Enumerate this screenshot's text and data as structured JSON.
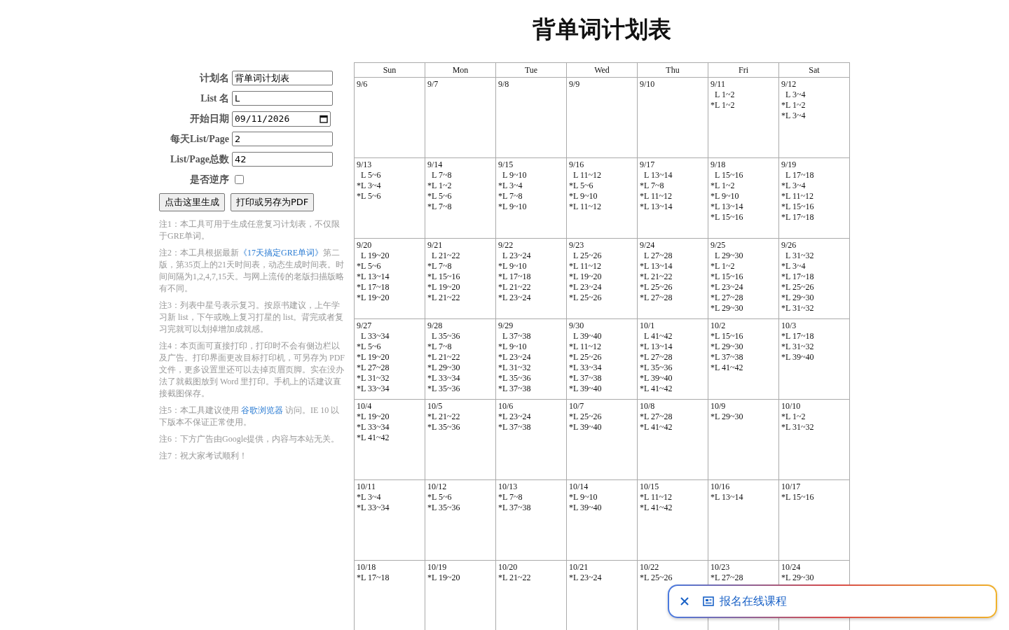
{
  "title": "背单词计划表",
  "form": {
    "fields": [
      {
        "kind": "text",
        "label": "计划名",
        "value": "背单词计划表"
      },
      {
        "kind": "text",
        "label": "List 名",
        "value": "L"
      },
      {
        "kind": "date",
        "label": "开始日期",
        "value": "09/11/2026"
      },
      {
        "kind": "text",
        "label": "每天List/Page",
        "value": "2"
      },
      {
        "kind": "text",
        "label": "List/Page总数",
        "value": "42"
      },
      {
        "kind": "checkbox",
        "label": "是否逆序",
        "checked": false
      }
    ],
    "buttons": [
      "点击这里生成",
      "打印或另存为PDF"
    ]
  },
  "notes": [
    {
      "text": "注1：本工具可用于生成任意复习计划表，不仅限于GRE单词。"
    },
    {
      "text": "注2：本工具根据最新",
      "link": "《17天搞定GRE单词》",
      "after": "第二版，第35页上的21天时间表，动态生成时间表。时间间隔为1,2,4,7,15天。与网上流传的老版扫描版略有不同。"
    },
    {
      "text": "注3：列表中星号表示复习。按原书建议，上午学习新 list，下午或晚上复习打星的 list。背完或者复习完就可以划掉增加成就感。"
    },
    {
      "text": "注4：本页面可直接打印，打印时不会有侧边栏以及广告。打印界面更改目标打印机，可另存为 PDF 文件，更多设置里还可以去掉页眉页脚。实在没办法了就截图放到 Word 里打印。手机上的话建议直接截图保存。"
    },
    {
      "text": "注5：本工具建议使用 ",
      "link": "谷歌浏览器",
      "after": " 访问。IE 10 以下版本不保证正常使用。"
    },
    {
      "text": "注6：下方广告由Google提供，内容与本站无关。"
    },
    {
      "text": "注7：祝大家考试顺利！"
    }
  ],
  "calendar": {
    "columns": [
      "Sun",
      "Mon",
      "Tue",
      "Wed",
      "Thu",
      "Fri",
      "Sat"
    ],
    "weeks": [
      [
        {
          "date": "9/6"
        },
        {
          "date": "9/7"
        },
        {
          "date": "9/8"
        },
        {
          "date": "9/9"
        },
        {
          "date": "9/10"
        },
        {
          "date": "9/11",
          "new": "L 1~2",
          "reviews": [
            "*L 1~2"
          ]
        },
        {
          "date": "9/12",
          "new": "L 3~4",
          "reviews": [
            "*L 1~2",
            "*L 3~4"
          ]
        }
      ],
      [
        {
          "date": "9/13",
          "new": "L 5~6",
          "reviews": [
            "*L 3~4",
            "*L 5~6"
          ]
        },
        {
          "date": "9/14",
          "new": "L 7~8",
          "reviews": [
            "*L 1~2",
            "*L 5~6",
            "*L 7~8"
          ]
        },
        {
          "date": "9/15",
          "new": "L 9~10",
          "reviews": [
            "*L 3~4",
            "*L 7~8",
            "*L 9~10"
          ]
        },
        {
          "date": "9/16",
          "new": "L 11~12",
          "reviews": [
            "*L 5~6",
            "*L 9~10",
            "*L 11~12"
          ]
        },
        {
          "date": "9/17",
          "new": "L 13~14",
          "reviews": [
            "*L 7~8",
            "*L 11~12",
            "*L 13~14"
          ]
        },
        {
          "date": "9/18",
          "new": "L 15~16",
          "reviews": [
            "*L 1~2",
            "*L 9~10",
            "*L 13~14",
            "*L 15~16"
          ]
        },
        {
          "date": "9/19",
          "new": "L 17~18",
          "reviews": [
            "*L 3~4",
            "*L 11~12",
            "*L 15~16",
            "*L 17~18"
          ]
        }
      ],
      [
        {
          "date": "9/20",
          "new": "L 19~20",
          "reviews": [
            "*L 5~6",
            "*L 13~14",
            "*L 17~18",
            "*L 19~20"
          ]
        },
        {
          "date": "9/21",
          "new": "L 21~22",
          "reviews": [
            "*L 7~8",
            "*L 15~16",
            "*L 19~20",
            "*L 21~22"
          ]
        },
        {
          "date": "9/22",
          "new": "L 23~24",
          "reviews": [
            "*L 9~10",
            "*L 17~18",
            "*L 21~22",
            "*L 23~24"
          ]
        },
        {
          "date": "9/23",
          "new": "L 25~26",
          "reviews": [
            "*L 11~12",
            "*L 19~20",
            "*L 23~24",
            "*L 25~26"
          ]
        },
        {
          "date": "9/24",
          "new": "L 27~28",
          "reviews": [
            "*L 13~14",
            "*L 21~22",
            "*L 25~26",
            "*L 27~28"
          ]
        },
        {
          "date": "9/25",
          "new": "L 29~30",
          "reviews": [
            "*L 1~2",
            "*L 15~16",
            "*L 23~24",
            "*L 27~28",
            "*L 29~30"
          ]
        },
        {
          "date": "9/26",
          "new": "L 31~32",
          "reviews": [
            "*L 3~4",
            "*L 17~18",
            "*L 25~26",
            "*L 29~30",
            "*L 31~32"
          ]
        }
      ],
      [
        {
          "date": "9/27",
          "new": "L 33~34",
          "reviews": [
            "*L 5~6",
            "*L 19~20",
            "*L 27~28",
            "*L 31~32",
            "*L 33~34"
          ]
        },
        {
          "date": "9/28",
          "new": "L 35~36",
          "reviews": [
            "*L 7~8",
            "*L 21~22",
            "*L 29~30",
            "*L 33~34",
            "*L 35~36"
          ]
        },
        {
          "date": "9/29",
          "new": "L 37~38",
          "reviews": [
            "*L 9~10",
            "*L 23~24",
            "*L 31~32",
            "*L 35~36",
            "*L 37~38"
          ]
        },
        {
          "date": "9/30",
          "new": "L 39~40",
          "reviews": [
            "*L 11~12",
            "*L 25~26",
            "*L 33~34",
            "*L 37~38",
            "*L 39~40"
          ]
        },
        {
          "date": "10/1",
          "new": "L 41~42",
          "reviews": [
            "*L 13~14",
            "*L 27~28",
            "*L 35~36",
            "*L 39~40",
            "*L 41~42"
          ]
        },
        {
          "date": "10/2",
          "reviews": [
            "*L 15~16",
            "*L 29~30",
            "*L 37~38",
            "*L 41~42"
          ]
        },
        {
          "date": "10/3",
          "reviews": [
            "*L 17~18",
            "*L 31~32",
            "*L 39~40"
          ]
        }
      ],
      [
        {
          "date": "10/4",
          "reviews": [
            "*L 19~20",
            "*L 33~34",
            "*L 41~42"
          ]
        },
        {
          "date": "10/5",
          "reviews": [
            "*L 21~22",
            "*L 35~36"
          ]
        },
        {
          "date": "10/6",
          "reviews": [
            "*L 23~24",
            "*L 37~38"
          ]
        },
        {
          "date": "10/7",
          "reviews": [
            "*L 25~26",
            "*L 39~40"
          ]
        },
        {
          "date": "10/8",
          "reviews": [
            "*L 27~28",
            "*L 41~42"
          ]
        },
        {
          "date": "10/9",
          "reviews": [
            "*L 29~30"
          ]
        },
        {
          "date": "10/10",
          "reviews": [
            "*L 1~2",
            "*L 31~32"
          ]
        }
      ],
      [
        {
          "date": "10/11",
          "reviews": [
            "*L 3~4",
            "*L 33~34"
          ]
        },
        {
          "date": "10/12",
          "reviews": [
            "*L 5~6",
            "*L 35~36"
          ]
        },
        {
          "date": "10/13",
          "reviews": [
            "*L 7~8",
            "*L 37~38"
          ]
        },
        {
          "date": "10/14",
          "reviews": [
            "*L 9~10",
            "*L 39~40"
          ]
        },
        {
          "date": "10/15",
          "reviews": [
            "*L 11~12",
            "*L 41~42"
          ]
        },
        {
          "date": "10/16",
          "reviews": [
            "*L 13~14"
          ]
        },
        {
          "date": "10/17",
          "reviews": [
            "*L 15~16"
          ]
        }
      ],
      [
        {
          "date": "10/18",
          "reviews": [
            "*L 17~18"
          ]
        },
        {
          "date": "10/19",
          "reviews": [
            "*L 19~20"
          ]
        },
        {
          "date": "10/20",
          "reviews": [
            "*L 21~22"
          ]
        },
        {
          "date": "10/21",
          "reviews": [
            "*L 23~24"
          ]
        },
        {
          "date": "10/22",
          "reviews": [
            "*L 25~26"
          ]
        },
        {
          "date": "10/23",
          "reviews": [
            "*L 27~28"
          ]
        },
        {
          "date": "10/24",
          "reviews": [
            "*L 29~30"
          ]
        }
      ]
    ]
  },
  "promo": {
    "label": "报名在线课程"
  }
}
